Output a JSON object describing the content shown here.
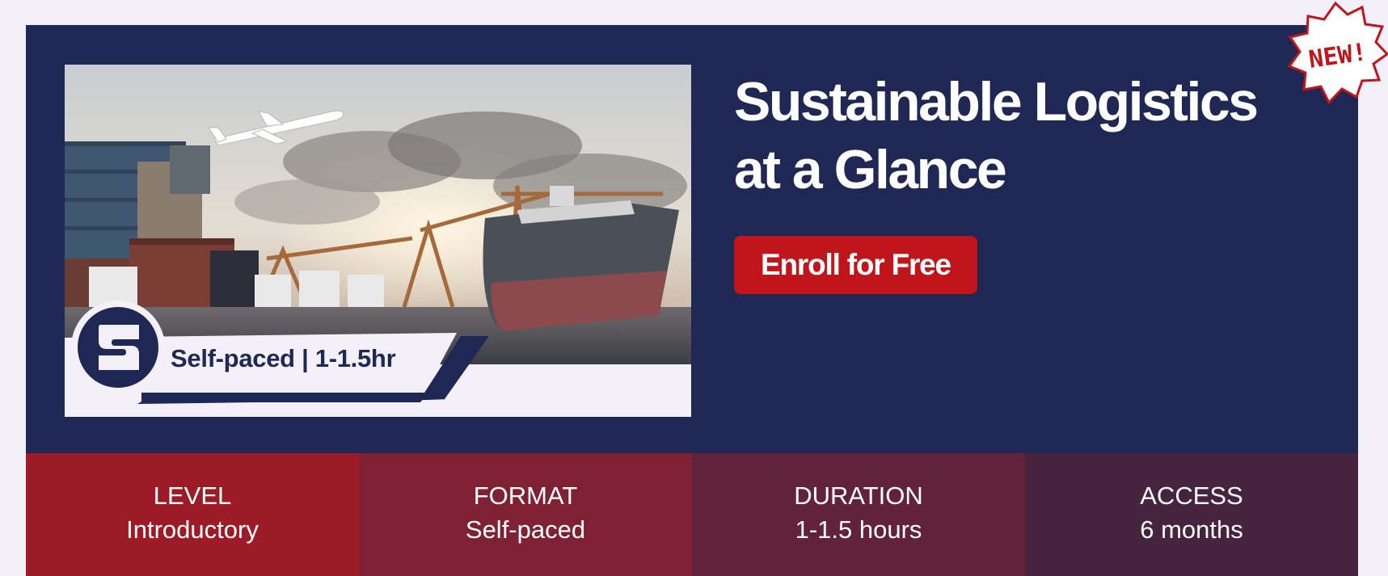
{
  "course": {
    "title_line1": "Sustainable Logistics",
    "title_line2": "at a Glance",
    "enroll_label": "Enroll for Free",
    "new_badge": "NEW!",
    "badge_text": "Self-paced | 1-1.5hr"
  },
  "stats": [
    {
      "label": "LEVEL",
      "value": "Introductory",
      "color": "#9d1b26"
    },
    {
      "label": "FORMAT",
      "value": "Self-paced",
      "color": "#7f2033"
    },
    {
      "label": "DURATION",
      "value": "1-1.5 hours",
      "color": "#63223b"
    },
    {
      "label": "ACCESS",
      "value": "6 months",
      "color": "#46233f"
    }
  ],
  "colors": {
    "navy": "#1f2754",
    "accent_red": "#c0161b",
    "page_bg": "#f3f0fa"
  },
  "icons": {
    "logo": "s-logo-icon",
    "new_badge": "starburst-badge-icon"
  }
}
